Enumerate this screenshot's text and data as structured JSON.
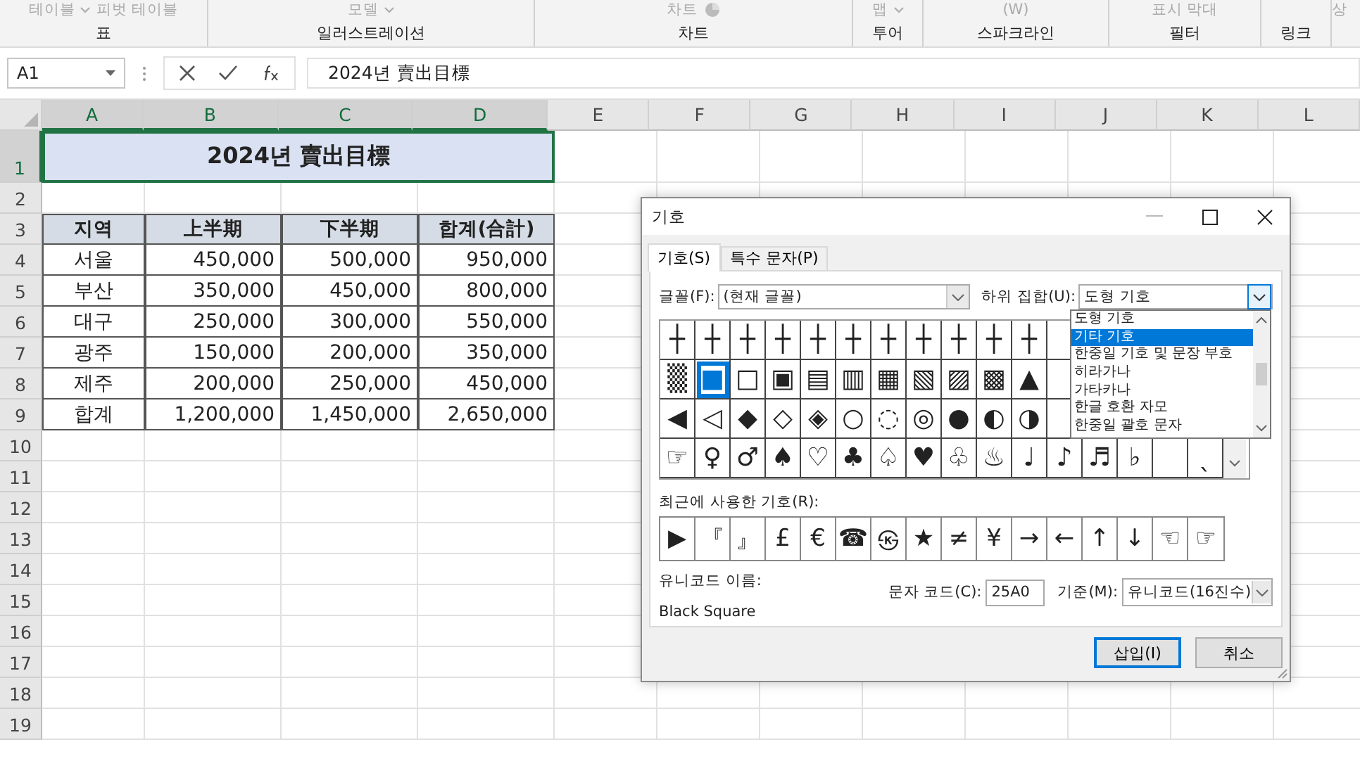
{
  "ribbon": {
    "groups": [
      {
        "label": "표",
        "commands": [
          "테이블",
          "피벗 테이블"
        ]
      },
      {
        "label": "일러스트레이션",
        "commands": [
          "모델"
        ]
      },
      {
        "label": "차트",
        "commands": [
          "차트"
        ]
      },
      {
        "label": "투어",
        "commands": [
          "맵"
        ]
      },
      {
        "label": "스파크라인",
        "commands": [
          "(W)"
        ]
      },
      {
        "label": "필터",
        "commands": [
          "표시 막대"
        ]
      },
      {
        "label": "링크"
      },
      {
        "commands": [
          "상"
        ]
      }
    ]
  },
  "formula_bar": {
    "name_box": "A1",
    "formula": "2024년 賣出目標"
  },
  "sheet": {
    "columns": [
      {
        "label": "A",
        "selected": true
      },
      {
        "label": "B",
        "selected": true
      },
      {
        "label": "C",
        "selected": true
      },
      {
        "label": "D",
        "selected": true
      },
      {
        "label": "E",
        "selected": false
      },
      {
        "label": "F",
        "selected": false
      },
      {
        "label": "G",
        "selected": false
      },
      {
        "label": "H",
        "selected": false
      },
      {
        "label": "I",
        "selected": false
      },
      {
        "label": "J",
        "selected": false
      },
      {
        "label": "K",
        "selected": false
      },
      {
        "label": "L",
        "selected": false
      }
    ],
    "rows": [
      {
        "label": "1",
        "selected": true
      },
      {
        "label": "2",
        "selected": false
      },
      {
        "label": "3",
        "selected": false
      },
      {
        "label": "4",
        "selected": false
      },
      {
        "label": "5",
        "selected": false
      },
      {
        "label": "6",
        "selected": false
      },
      {
        "label": "7",
        "selected": false
      },
      {
        "label": "8",
        "selected": false
      },
      {
        "label": "9",
        "selected": false
      },
      {
        "label": "10",
        "selected": false
      },
      {
        "label": "11",
        "selected": false
      },
      {
        "label": "12",
        "selected": false
      },
      {
        "label": "13",
        "selected": false
      },
      {
        "label": "14",
        "selected": false
      },
      {
        "label": "15",
        "selected": false
      },
      {
        "label": "16",
        "selected": false
      },
      {
        "label": "17",
        "selected": false
      },
      {
        "label": "18",
        "selected": false
      },
      {
        "label": "19",
        "selected": false
      }
    ],
    "title": "2024년 賣出目標",
    "table": {
      "header": [
        "지역",
        "上半期",
        "下半期",
        "합계(合計)"
      ],
      "rows": [
        [
          "서울",
          "450,000",
          "500,000",
          "950,000"
        ],
        [
          "부산",
          "350,000",
          "450,000",
          "800,000"
        ],
        [
          "대구",
          "250,000",
          "300,000",
          "550,000"
        ],
        [
          "광주",
          "150,000",
          "200,000",
          "350,000"
        ],
        [
          "제주",
          "200,000",
          "250,000",
          "450,000"
        ],
        [
          "합계",
          "1,200,000",
          "1,450,000",
          "2,650,000"
        ]
      ]
    }
  },
  "dialog": {
    "title": "기호",
    "tabs": [
      {
        "label": "기호(S)",
        "selected": true
      },
      {
        "label": "특수 문자(P)",
        "selected": false
      }
    ],
    "font_label": "글꼴(F):",
    "font": "(현재 글꼴)",
    "subset_label": "하위 집합(U):",
    "subset": "도형 기호",
    "subset_options": [
      {
        "label": "도형 기호",
        "selected": false
      },
      {
        "label": "기타 기호",
        "selected": true
      },
      {
        "label": "한중일 기호 및 문장 부호",
        "selected": false
      },
      {
        "label": "히라가나",
        "selected": false
      },
      {
        "label": "가타카나",
        "selected": false
      },
      {
        "label": "한글 호환 자모",
        "selected": false
      },
      {
        "label": "한중일 괄호 문자",
        "selected": false
      }
    ],
    "symbols": [
      [
        {
          "kind": "glyph",
          "s": "┼",
          "selected": false
        },
        {
          "kind": "glyph",
          "s": "┼",
          "selected": false
        },
        {
          "kind": "glyph",
          "s": "┼",
          "selected": false
        },
        {
          "kind": "glyph",
          "s": "┼",
          "selected": false
        },
        {
          "kind": "glyph",
          "s": "┼",
          "selected": false
        },
        {
          "kind": "glyph",
          "s": "┼",
          "selected": false
        },
        {
          "kind": "glyph",
          "s": "┼",
          "selected": false
        },
        {
          "kind": "glyph",
          "s": "┼",
          "selected": false
        },
        {
          "kind": "glyph",
          "s": "┼",
          "selected": false
        },
        {
          "kind": "glyph",
          "s": "┼",
          "selected": false
        },
        {
          "kind": "glyph",
          "s": "┼",
          "selected": false
        }
      ],
      [
        {
          "kind": "glyph",
          "s": "▒",
          "selected": false
        },
        {
          "kind": "glyph",
          "s": "■",
          "selected": true
        },
        {
          "kind": "glyph",
          "s": "□",
          "selected": false
        },
        {
          "kind": "glyph",
          "s": "▣",
          "selected": false
        },
        {
          "kind": "glyph",
          "s": "▤",
          "selected": false
        },
        {
          "kind": "glyph",
          "s": "▥",
          "selected": false
        },
        {
          "kind": "glyph",
          "s": "▦",
          "selected": false
        },
        {
          "kind": "glyph",
          "s": "▧",
          "selected": false
        },
        {
          "kind": "glyph",
          "s": "▨",
          "selected": false
        },
        {
          "kind": "glyph",
          "s": "▩",
          "selected": false
        },
        {
          "kind": "glyph",
          "s": "▲",
          "selected": false
        }
      ],
      [
        {
          "kind": "glyph",
          "s": "◀",
          "selected": false
        },
        {
          "kind": "glyph",
          "s": "◁",
          "selected": false
        },
        {
          "kind": "glyph",
          "s": "◆",
          "selected": false
        },
        {
          "kind": "glyph",
          "s": "◇",
          "selected": false
        },
        {
          "kind": "glyph",
          "s": "◈",
          "selected": false
        },
        {
          "kind": "glyph",
          "s": "○",
          "selected": false
        },
        {
          "kind": "glyph",
          "s": "◌",
          "selected": false
        },
        {
          "kind": "glyph",
          "s": "◎",
          "selected": false
        },
        {
          "kind": "glyph",
          "s": "●",
          "selected": false
        },
        {
          "kind": "glyph",
          "s": "◐",
          "selected": false
        },
        {
          "kind": "glyph",
          "s": "◑",
          "selected": false
        }
      ],
      [
        {
          "kind": "glyph",
          "s": "☞",
          "selected": false
        },
        {
          "kind": "glyph",
          "s": "♀",
          "selected": false
        },
        {
          "kind": "glyph",
          "s": "♂",
          "selected": false
        },
        {
          "kind": "glyph",
          "s": "♠",
          "selected": false
        },
        {
          "kind": "glyph",
          "s": "♡",
          "selected": false
        },
        {
          "kind": "glyph",
          "s": "♣",
          "selected": false
        },
        {
          "kind": "glyph",
          "s": "♤",
          "selected": false
        },
        {
          "kind": "glyph",
          "s": "♥",
          "selected": false
        },
        {
          "kind": "glyph",
          "s": "♧",
          "selected": false
        },
        {
          "kind": "glyph",
          "s": "♨",
          "selected": false
        },
        {
          "kind": "glyph",
          "s": "♩",
          "selected": false
        },
        {
          "kind": "glyph",
          "s": "♪",
          "selected": false
        },
        {
          "kind": "glyph",
          "s": "♬",
          "selected": false
        },
        {
          "kind": "glyph",
          "s": "♭",
          "selected": false
        },
        {
          "kind": "empty",
          "selected": false
        },
        {
          "kind": "glyph",
          "s": "ˎ",
          "selected": false
        }
      ]
    ],
    "recent_label": "최근에 사용한 기호(R):",
    "recent": [
      "▶",
      "『",
      "』",
      "£",
      "€",
      "☎",
      "㉿",
      "★",
      "≠",
      "¥",
      "→",
      "←",
      "↑",
      "↓",
      "☜",
      "☞"
    ],
    "unicode_name_label": "유니코드 이름:",
    "unicode_name": "Black Square",
    "code_label": "문자 코드(C):",
    "code": "25A0",
    "base_label": "기준(M):",
    "base": "유니코드(16진수)",
    "buttons": [
      {
        "label": "삽입(I)",
        "kind": "default"
      },
      {
        "label": "취소",
        "kind": "normal"
      }
    ]
  }
}
